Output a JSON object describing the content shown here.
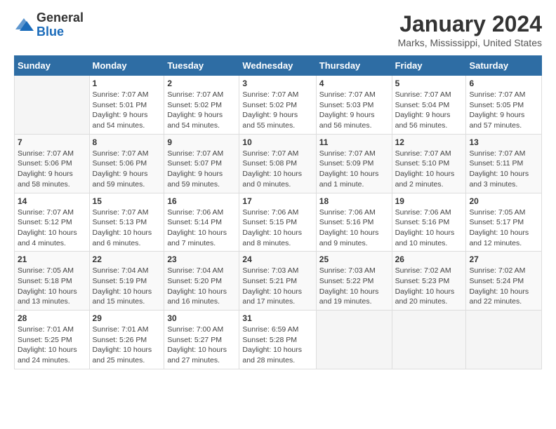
{
  "header": {
    "logo_general": "General",
    "logo_blue": "Blue",
    "title": "January 2024",
    "subtitle": "Marks, Mississippi, United States"
  },
  "days_of_week": [
    "Sunday",
    "Monday",
    "Tuesday",
    "Wednesday",
    "Thursday",
    "Friday",
    "Saturday"
  ],
  "weeks": [
    [
      {
        "day": "",
        "info": ""
      },
      {
        "day": "1",
        "info": "Sunrise: 7:07 AM\nSunset: 5:01 PM\nDaylight: 9 hours\nand 54 minutes."
      },
      {
        "day": "2",
        "info": "Sunrise: 7:07 AM\nSunset: 5:02 PM\nDaylight: 9 hours\nand 54 minutes."
      },
      {
        "day": "3",
        "info": "Sunrise: 7:07 AM\nSunset: 5:02 PM\nDaylight: 9 hours\nand 55 minutes."
      },
      {
        "day": "4",
        "info": "Sunrise: 7:07 AM\nSunset: 5:03 PM\nDaylight: 9 hours\nand 56 minutes."
      },
      {
        "day": "5",
        "info": "Sunrise: 7:07 AM\nSunset: 5:04 PM\nDaylight: 9 hours\nand 56 minutes."
      },
      {
        "day": "6",
        "info": "Sunrise: 7:07 AM\nSunset: 5:05 PM\nDaylight: 9 hours\nand 57 minutes."
      }
    ],
    [
      {
        "day": "7",
        "info": "Sunrise: 7:07 AM\nSunset: 5:06 PM\nDaylight: 9 hours\nand 58 minutes."
      },
      {
        "day": "8",
        "info": "Sunrise: 7:07 AM\nSunset: 5:06 PM\nDaylight: 9 hours\nand 59 minutes."
      },
      {
        "day": "9",
        "info": "Sunrise: 7:07 AM\nSunset: 5:07 PM\nDaylight: 9 hours\nand 59 minutes."
      },
      {
        "day": "10",
        "info": "Sunrise: 7:07 AM\nSunset: 5:08 PM\nDaylight: 10 hours\nand 0 minutes."
      },
      {
        "day": "11",
        "info": "Sunrise: 7:07 AM\nSunset: 5:09 PM\nDaylight: 10 hours\nand 1 minute."
      },
      {
        "day": "12",
        "info": "Sunrise: 7:07 AM\nSunset: 5:10 PM\nDaylight: 10 hours\nand 2 minutes."
      },
      {
        "day": "13",
        "info": "Sunrise: 7:07 AM\nSunset: 5:11 PM\nDaylight: 10 hours\nand 3 minutes."
      }
    ],
    [
      {
        "day": "14",
        "info": "Sunrise: 7:07 AM\nSunset: 5:12 PM\nDaylight: 10 hours\nand 4 minutes."
      },
      {
        "day": "15",
        "info": "Sunrise: 7:07 AM\nSunset: 5:13 PM\nDaylight: 10 hours\nand 6 minutes."
      },
      {
        "day": "16",
        "info": "Sunrise: 7:06 AM\nSunset: 5:14 PM\nDaylight: 10 hours\nand 7 minutes."
      },
      {
        "day": "17",
        "info": "Sunrise: 7:06 AM\nSunset: 5:15 PM\nDaylight: 10 hours\nand 8 minutes."
      },
      {
        "day": "18",
        "info": "Sunrise: 7:06 AM\nSunset: 5:16 PM\nDaylight: 10 hours\nand 9 minutes."
      },
      {
        "day": "19",
        "info": "Sunrise: 7:06 AM\nSunset: 5:16 PM\nDaylight: 10 hours\nand 10 minutes."
      },
      {
        "day": "20",
        "info": "Sunrise: 7:05 AM\nSunset: 5:17 PM\nDaylight: 10 hours\nand 12 minutes."
      }
    ],
    [
      {
        "day": "21",
        "info": "Sunrise: 7:05 AM\nSunset: 5:18 PM\nDaylight: 10 hours\nand 13 minutes."
      },
      {
        "day": "22",
        "info": "Sunrise: 7:04 AM\nSunset: 5:19 PM\nDaylight: 10 hours\nand 15 minutes."
      },
      {
        "day": "23",
        "info": "Sunrise: 7:04 AM\nSunset: 5:20 PM\nDaylight: 10 hours\nand 16 minutes."
      },
      {
        "day": "24",
        "info": "Sunrise: 7:03 AM\nSunset: 5:21 PM\nDaylight: 10 hours\nand 17 minutes."
      },
      {
        "day": "25",
        "info": "Sunrise: 7:03 AM\nSunset: 5:22 PM\nDaylight: 10 hours\nand 19 minutes."
      },
      {
        "day": "26",
        "info": "Sunrise: 7:02 AM\nSunset: 5:23 PM\nDaylight: 10 hours\nand 20 minutes."
      },
      {
        "day": "27",
        "info": "Sunrise: 7:02 AM\nSunset: 5:24 PM\nDaylight: 10 hours\nand 22 minutes."
      }
    ],
    [
      {
        "day": "28",
        "info": "Sunrise: 7:01 AM\nSunset: 5:25 PM\nDaylight: 10 hours\nand 24 minutes."
      },
      {
        "day": "29",
        "info": "Sunrise: 7:01 AM\nSunset: 5:26 PM\nDaylight: 10 hours\nand 25 minutes."
      },
      {
        "day": "30",
        "info": "Sunrise: 7:00 AM\nSunset: 5:27 PM\nDaylight: 10 hours\nand 27 minutes."
      },
      {
        "day": "31",
        "info": "Sunrise: 6:59 AM\nSunset: 5:28 PM\nDaylight: 10 hours\nand 28 minutes."
      },
      {
        "day": "",
        "info": ""
      },
      {
        "day": "",
        "info": ""
      },
      {
        "day": "",
        "info": ""
      }
    ]
  ]
}
